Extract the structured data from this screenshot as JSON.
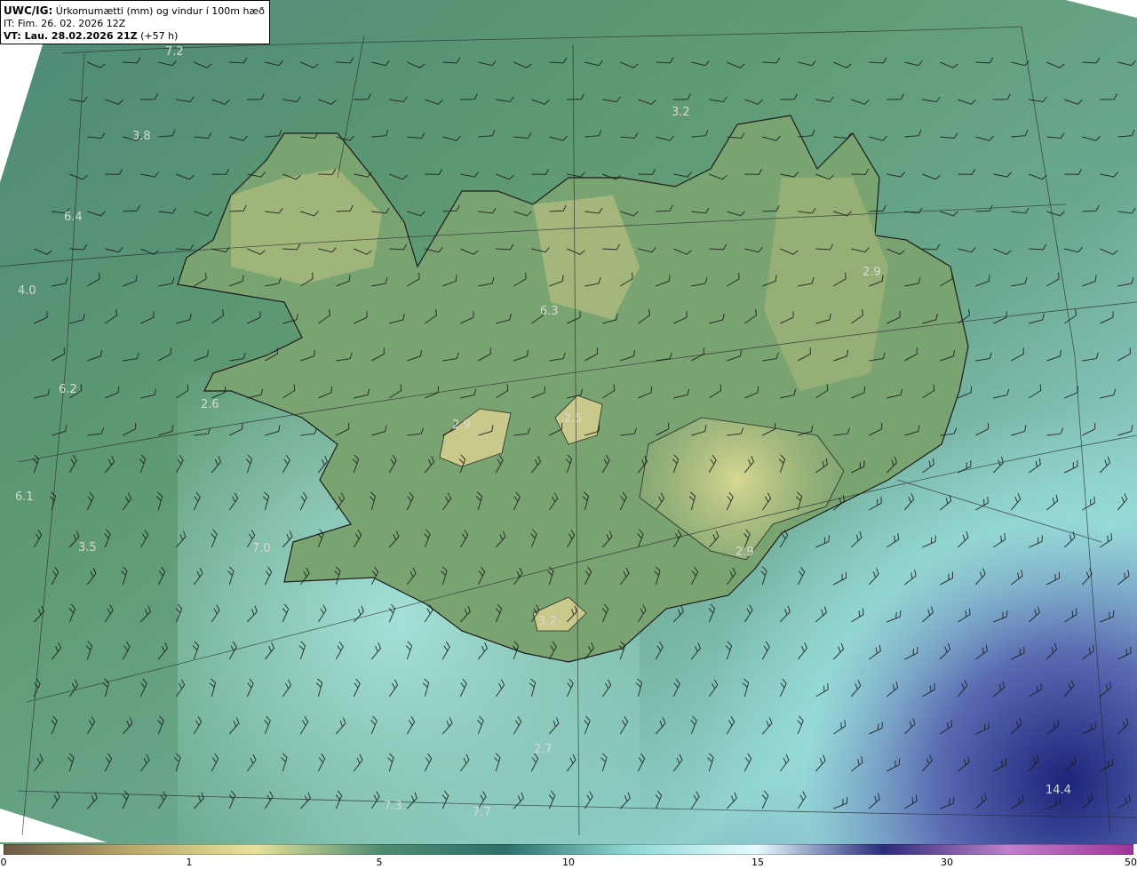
{
  "header": {
    "product": "UWC/IG:",
    "variable": "Úrkomumætti (mm) og vindur í 100m hæð",
    "it_line": "IT: Fim. 26. 02. 2026 12Z",
    "vt_label": "VT: Lau. 28.02.2026 21Z",
    "vt_lead": "(+57 h)"
  },
  "map_labels": [
    "7.2",
    "3.2",
    "3.8",
    "6.4",
    "4.0",
    "6.2",
    "6.1",
    "3.5",
    "7.0",
    "2.9",
    "6.3",
    "2.9",
    "2.5",
    "2.6",
    "2.9",
    "3.2",
    "14.4",
    "7.3",
    "2.7",
    "7.7"
  ],
  "colorbar": {
    "ticks": [
      "0",
      "1",
      "5",
      "10",
      "15",
      "30",
      "50"
    ],
    "colors": [
      "#6b5a44",
      "#b9a66a",
      "#e6e29a",
      "#4f8d72",
      "#2e6f6a",
      "#8fd9d4",
      "#e6fbff",
      "#2a2b7a",
      "#c080c8",
      "#a0349a"
    ]
  }
}
